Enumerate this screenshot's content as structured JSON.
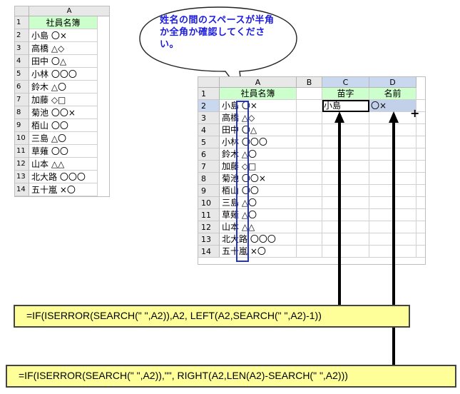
{
  "left_sheet": {
    "column_header": "A",
    "rows": [
      {
        "num": "1",
        "value": "社員名簿",
        "header": true
      },
      {
        "num": "2",
        "value": "小島 〇×"
      },
      {
        "num": "3",
        "value": "高橋 △◇"
      },
      {
        "num": "4",
        "value": "田中 〇△"
      },
      {
        "num": "5",
        "value": "小林 〇〇〇"
      },
      {
        "num": "6",
        "value": "鈴木 △〇"
      },
      {
        "num": "7",
        "value": "加藤 ◇□"
      },
      {
        "num": "8",
        "value": "菊池 〇〇×"
      },
      {
        "num": "9",
        "value": "栢山 〇〇"
      },
      {
        "num": "10",
        "value": "三島 △〇"
      },
      {
        "num": "11",
        "value": "草薙 〇〇"
      },
      {
        "num": "12",
        "value": "山本 △△"
      },
      {
        "num": "13",
        "value": "北大路 〇〇〇"
      },
      {
        "num": "14",
        "value": "五十嵐 ×〇"
      }
    ]
  },
  "callout": {
    "text": "姓名の間のスペースが半角か全角か確認してください。"
  },
  "right_sheet": {
    "columns": [
      "A",
      "B",
      "C",
      "D"
    ],
    "headers": {
      "C": "苗字",
      "D": "名前"
    },
    "rows": [
      {
        "num": "1",
        "value": "社員名簿",
        "header": true
      },
      {
        "num": "2",
        "value": "小島 〇×",
        "C": "小島",
        "D": "〇×"
      },
      {
        "num": "3",
        "value": "高橋 △◇"
      },
      {
        "num": "4",
        "value": "田中 〇△"
      },
      {
        "num": "5",
        "value": "小林 〇〇〇"
      },
      {
        "num": "6",
        "value": "鈴木 △〇"
      },
      {
        "num": "7",
        "value": "加藤 ◇□"
      },
      {
        "num": "8",
        "value": "菊池 〇〇×"
      },
      {
        "num": "9",
        "value": "栢山 〇〇"
      },
      {
        "num": "10",
        "value": "三島 △〇"
      },
      {
        "num": "11",
        "value": "草薙 △〇"
      },
      {
        "num": "12",
        "value": "山本 △△"
      },
      {
        "num": "13",
        "value": "北大路 〇〇〇"
      },
      {
        "num": "14",
        "value": "五十嵐 ×〇"
      }
    ],
    "fill_handle": "+"
  },
  "formulas": {
    "surname": "=IF(ISERROR(SEARCH(\" \",A2)),A2, LEFT(A2,SEARCH(\" \",A2)-1))",
    "given_name": "=IF(ISERROR(SEARCH(\" \",A2)),\"\", RIGHT(A2,LEN(A2)-SEARCH(\" \",A2)))"
  },
  "colors": {
    "header_fill": "#ccffcc",
    "formula_fill": "#ffff99",
    "callout_text": "#1a1ae0",
    "highlight_border": "#2233cc",
    "selected_header": "#c9d8ef"
  }
}
